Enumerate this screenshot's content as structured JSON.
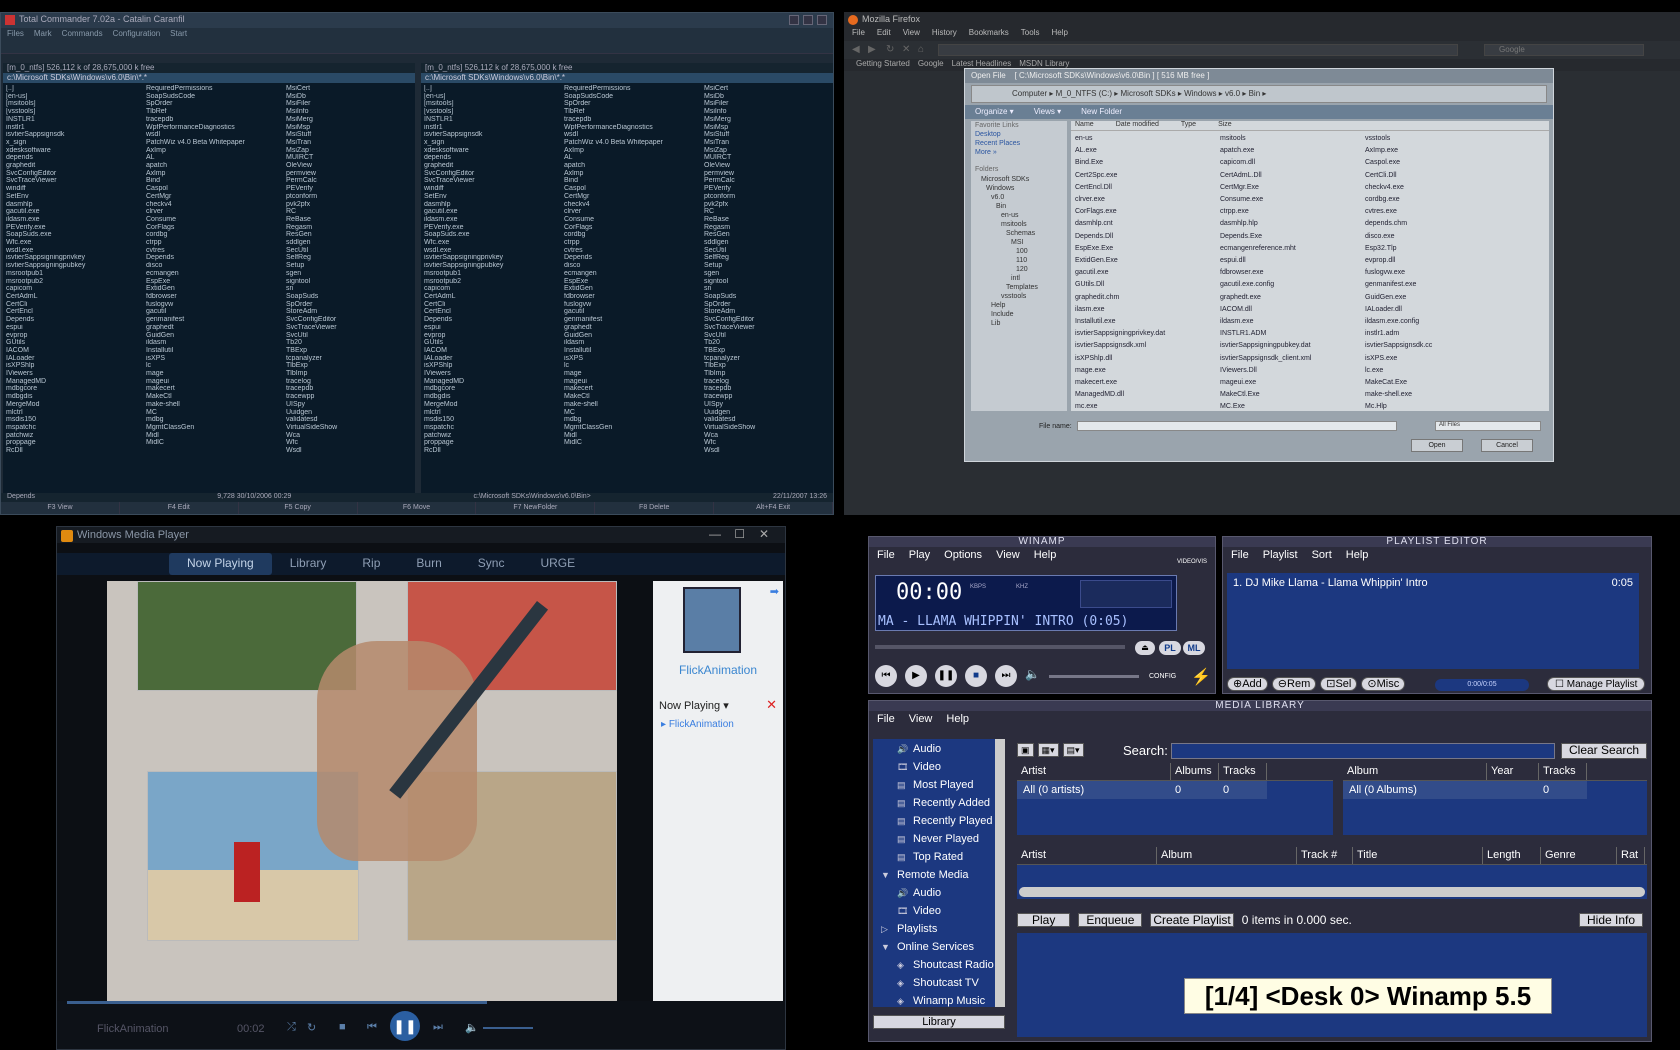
{
  "tc": {
    "title": "Total Commander 7.02a - Catalin Caranfil",
    "menu": [
      "Files",
      "Mark",
      "Commands",
      "Configuration",
      "Start"
    ],
    "drive_info": "[m_0_ntfs]  526,112 k of 28,675,000 k free",
    "path": "c:\\Microsoft SDKs\\Windows\\v6.0\\Bin\\*.*",
    "files": [
      "[..]",
      "[en-us]",
      "[msitools]",
      "[vsstools]",
      "INSTLR1",
      "instlr1",
      "isvtierSappsignsdk",
      "x_sign",
      "xdesksoftware",
      "depends",
      "graphedit",
      "SvcConfigEditor",
      "SvcTraceViewer",
      "windiff",
      "SetEnv",
      "dasmhlp",
      "gacutil.exe",
      "ildasm.exe",
      "PEVerify.exe",
      "SoapSuds.exe",
      "Wfc.exe",
      "wsdl.exe",
      "isvtierSappsigningprivkey",
      "isvtierSappsigningpubkey",
      "msrootpub1",
      "msrootpub2",
      "capicom",
      "CertAdmL",
      "CertCli",
      "CertEncl",
      "Depends",
      "espui",
      "evprop",
      "GUtils",
      "IACOM",
      "IALoader",
      "isXPShlp",
      "IViewers",
      "ManagedMD",
      "mdbgcore",
      "mdbgdis",
      "MergeMod",
      "mlctrl",
      "msdis150",
      "mspatchc",
      "patchwiz",
      "proppage",
      "RcDll"
    ],
    "files2": [
      "RequiredPermissions",
      "SoapSudsCode",
      "SpOrder",
      "TlbRef",
      "tracepdb",
      "WpfPerformanceDiagnostics",
      "wsdl",
      "PatchWiz v4.0 Beta Whitepaper",
      "AxImp",
      "AL",
      "apatch",
      "Axlmp",
      "Bind",
      "Caspol",
      "CertMgr",
      "checkv4",
      "clrver",
      "Consume",
      "CorFlags",
      "cordbg",
      "ctrpp",
      "cvtres",
      "Depends",
      "disco",
      "ecmangen",
      "EspExe",
      "ExtidGen",
      "fdbrowser",
      "fuslogvw",
      "gacutil",
      "genmanifest",
      "graphedt",
      "GuidGen",
      "ildasm",
      "Installutil",
      "isXPS",
      "lc",
      "mage",
      "mageui",
      "makecert",
      "MakeCtl",
      "make-shell",
      "MC",
      "mdbg",
      "MgmtClassGen",
      "Midl",
      "MidlC"
    ],
    "files3": [
      "MsiCert",
      "MsiDb",
      "MsiFiler",
      "MsiInfo",
      "MsiMerg",
      "MsiMsp",
      "MsiStuff",
      "MsiTran",
      "MsiZap",
      "MUIRCT",
      "OleView",
      "permview",
      "PermCalc",
      "PEVerify",
      "ptconform",
      "pvk2pfx",
      "RC",
      "ReBase",
      "Regasm",
      "ResGen",
      "sddlgen",
      "SecUtil",
      "SelfReg",
      "Setup",
      "sgen",
      "signtool",
      "sn",
      "SoapSuds",
      "SpOrder",
      "StoreAdm",
      "SvcConfigEditor",
      "SvcTraceViewer",
      "SvcUtil",
      "Tb20",
      "TBExp",
      "tcpanalyzer",
      "TlbExp",
      "TlbImp",
      "tracelog",
      "tracepdb",
      "tracewpp",
      "UISpy",
      "Uuidgen",
      "validatesd",
      "VirtualSideShow",
      "Wca",
      "Wfc",
      "Wsdl"
    ],
    "status_left": "Depends",
    "status_mid": "9,728  30/10/2006 00:29",
    "status_right": "22/11/2007 13:26",
    "cmdline": "c:\\Microsoft SDKs\\Windows\\v6.0\\Bin>",
    "fkeys": [
      "F3 View",
      "F4 Edit",
      "F5 Copy",
      "F6 Move",
      "F7 NewFolder",
      "F8 Delete",
      "Alt+F4 Exit"
    ]
  },
  "ff": {
    "title": "Mozilla Firefox",
    "menu": [
      "File",
      "Edit",
      "View",
      "History",
      "Bookmarks",
      "Tools",
      "Help"
    ],
    "search_placeholder": "Google",
    "bookmarks": [
      "Getting Started",
      "Google",
      "Latest Headlines",
      "MSDN Library"
    ]
  },
  "dlg": {
    "title": "Open File",
    "path_info": "[ C:\\Microsoft SDKs\\Windows\\v6.0\\Bin ] [ 516 MB free ]",
    "breadcrumb": "Computer ▸ M_0_NTFS (C:) ▸ Microsoft SDKs ▸ Windows ▸ v6.0 ▸ Bin ▸",
    "toolbar": [
      "Organize ▾",
      "Views ▾",
      "New Folder"
    ],
    "links_header": "Favorite Links",
    "links": [
      "Desktop",
      "Recent Places",
      "More »"
    ],
    "folders_header": "Folders",
    "tree": [
      "Microsoft SDKs",
      "Windows",
      "v6.0",
      "Bin",
      "en-us",
      "msitools",
      "Schemas",
      "MSI",
      "100",
      "110",
      "120",
      "intl",
      "Templates",
      "vsstools",
      "Help",
      "Include",
      "Lib"
    ],
    "cols": [
      "Name",
      "Date modified",
      "Type",
      "Size"
    ],
    "files": [
      "en-us",
      "msitools",
      "vsstools",
      "AL.exe",
      "apatch.exe",
      "AxImp.exe",
      "Bind.Exe",
      "capicom.dll",
      "Caspol.exe",
      "Cert2Spc.exe",
      "CertAdmL.Dll",
      "CertCli.Dll",
      "CertEncl.Dll",
      "CertMgr.Exe",
      "checkv4.exe",
      "clrver.exe",
      "Consume.exe",
      "cordbg.exe",
      "CorFlags.exe",
      "ctrpp.exe",
      "cvtres.exe",
      "dasmhlp.cnt",
      "dasmhlp.hlp",
      "depends.chm",
      "Depends.Dll",
      "Depends.Exe",
      "disco.exe",
      "EspExe.Exe",
      "ecmangenreference.mht",
      "Esp32.Tlp",
      "ExtidGen.Exe",
      "espui.dll",
      "evprop.dll",
      "gacutil.exe",
      "fdbrowser.exe",
      "fuslogvw.exe",
      "GUtils.Dll",
      "gacutil.exe.config",
      "genmanifest.exe",
      "graphedit.chm",
      "graphedt.exe",
      "GuidGen.exe",
      "ilasm.exe",
      "IACOM.dll",
      "IALoader.dll",
      "Installutil.exe",
      "ildasm.exe",
      "ildasm.exe.config",
      "isvtierSappsigningprivkey.dat",
      "INSTLR1.ADM",
      "instlr1.adm",
      "isvtierSappsignsdk.xml",
      "isvtierSappsigningpubkey.dat",
      "isvtierSappsignsdk.cc",
      "isXPShlp.dll",
      "isvtierSappsignsdk_client.xml",
      "isXPS.exe",
      "mage.exe",
      "IViewers.Dll",
      "lc.exe",
      "makecert.exe",
      "mageui.exe",
      "MakeCat.Exe",
      "ManagedMD.dll",
      "MakeCtl.Exe",
      "make-shell.exe",
      "mc.exe",
      "MC.Exe",
      "Mc.Hlp"
    ],
    "filename_label": "File name:",
    "filetype": "All Files",
    "open_btn": "Open",
    "cancel_btn": "Cancel"
  },
  "wmp": {
    "title": "Windows Media Player",
    "tabs": [
      "Now Playing",
      "Library",
      "Rip",
      "Burn",
      "Sync",
      "URGE"
    ],
    "album_title": "FlickAnimation",
    "now_playing_label": "Now Playing",
    "playlist_item": "FlickAnimation",
    "bottom_title": "FlickAnimation",
    "time": "00:02"
  },
  "winamp": {
    "main_title": "WINAMP",
    "menu": [
      "File",
      "Play",
      "Options",
      "View",
      "Help"
    ],
    "time": "00:00",
    "kbps_label": "KBPS",
    "khz_label": "KHZ",
    "ticker": "MA - LLAMA WHIPPIN' INTRO (0:05)",
    "video_vis_label": "VIDEO/VIS",
    "config_label": "CONFIG",
    "pl_btn": "PL",
    "ml_btn": "ML"
  },
  "playlist": {
    "title": "PLAYLIST EDITOR",
    "menu": [
      "File",
      "Playlist",
      "Sort",
      "Help"
    ],
    "items": [
      {
        "title": "1. DJ Mike Llama - Llama Whippin' Intro",
        "length": "0:05"
      }
    ],
    "buttons": [
      "Add",
      "Rem",
      "Sel",
      "Misc"
    ],
    "time_display": "0:00/0:05",
    "manage_btn": "Manage Playlist"
  },
  "ml": {
    "title": "MEDIA LIBRARY",
    "menu": [
      "File",
      "View",
      "Help"
    ],
    "tree": [
      {
        "label": "Audio",
        "indent": 1,
        "icon": "audio"
      },
      {
        "label": "Video",
        "indent": 1,
        "icon": "video"
      },
      {
        "label": "Most Played",
        "indent": 1,
        "icon": "list"
      },
      {
        "label": "Recently Added",
        "indent": 1,
        "icon": "list"
      },
      {
        "label": "Recently Played",
        "indent": 1,
        "icon": "list"
      },
      {
        "label": "Never Played",
        "indent": 1,
        "icon": "list"
      },
      {
        "label": "Top Rated",
        "indent": 1,
        "icon": "list"
      },
      {
        "label": "Remote Media",
        "indent": 0,
        "icon": "expanded"
      },
      {
        "label": "Audio",
        "indent": 1,
        "icon": "audio"
      },
      {
        "label": "Video",
        "indent": 1,
        "icon": "video"
      },
      {
        "label": "Playlists",
        "indent": 0,
        "icon": "collapsed"
      },
      {
        "label": "Online Services",
        "indent": 0,
        "icon": "expanded"
      },
      {
        "label": "Shoutcast Radio",
        "indent": 1,
        "icon": "online"
      },
      {
        "label": "Shoutcast TV",
        "indent": 1,
        "icon": "online"
      },
      {
        "label": "Winamp Music",
        "indent": 1,
        "icon": "online"
      }
    ],
    "search_label": "Search:",
    "clear_search": "Clear Search",
    "artist_cols": [
      "Artist",
      "Albums",
      "Tracks"
    ],
    "artist_row": [
      "All (0 artists)",
      "0",
      "0"
    ],
    "album_cols": [
      "Album",
      "Year",
      "Tracks"
    ],
    "album_row": [
      "All (0 Albums)",
      "",
      "0"
    ],
    "track_cols": [
      "Artist",
      "Album",
      "Track #",
      "Title",
      "Length",
      "Genre",
      "Rat"
    ],
    "buttons": [
      "Play",
      "Enqueue",
      "Create Playlist"
    ],
    "items_info": "0 items  in 0.000 sec.",
    "hide_info": "Hide Info",
    "library_btn": "Library"
  },
  "desk_label": "[1/4] <Desk 0> Winamp 5.5"
}
